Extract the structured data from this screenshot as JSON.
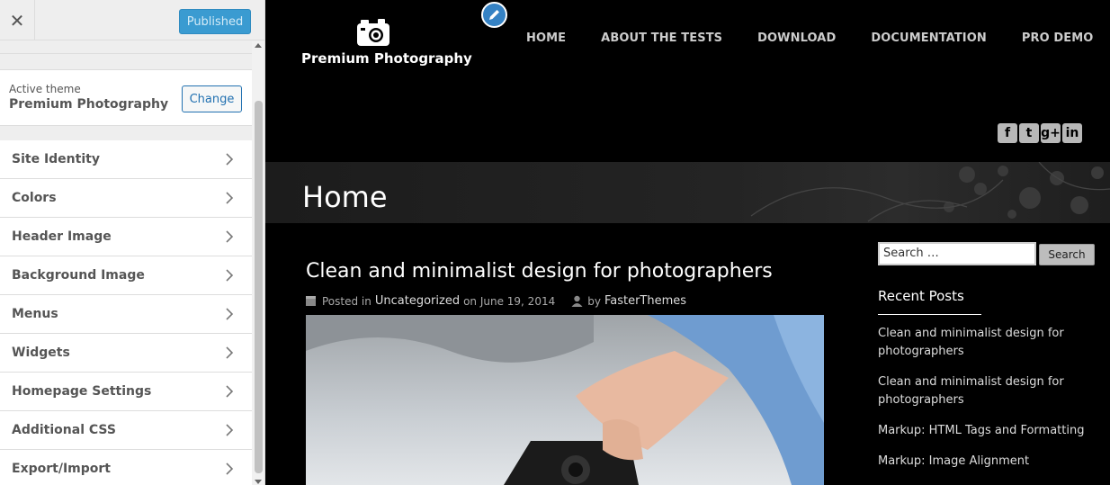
{
  "sidebar": {
    "close_label": "✕",
    "publish_label": "Published",
    "active_theme_label": "Active theme",
    "active_theme_name": "Premium Photography",
    "change_label": "Change",
    "panels": [
      {
        "label": "Site Identity"
      },
      {
        "label": "Colors"
      },
      {
        "label": "Header Image"
      },
      {
        "label": "Background Image"
      },
      {
        "label": "Menus"
      },
      {
        "label": "Widgets"
      },
      {
        "label": "Homepage Settings"
      },
      {
        "label": "Additional CSS"
      },
      {
        "label": "Export/Import"
      }
    ]
  },
  "site": {
    "title": "Premium Photography",
    "nav": [
      "HOME",
      "ABOUT THE TESTS",
      "DOWNLOAD",
      "DOCUMENTATION",
      "PRO DEMO"
    ],
    "social_icons": [
      "facebook-icon",
      "twitter-icon",
      "google-plus-icon",
      "linkedin-icon"
    ],
    "social_glyphs": [
      "f",
      "t",
      "g+",
      "in"
    ],
    "page_heading": "Home"
  },
  "post": {
    "title": "Clean and minimalist design for photographers",
    "posted_in_prefix": "Posted in",
    "category": "Uncategorized",
    "date_text": "on June 19, 2014",
    "by_prefix": "by",
    "author": "FasterThemes"
  },
  "widgets": {
    "search_placeholder": "Search …",
    "search_button": "Search",
    "recent_heading": "Recent Posts",
    "recent_posts": [
      "Clean and minimalist design for photographers",
      "Clean and minimalist design for photographers",
      "Markup: HTML Tags and Formatting",
      "Markup: Image Alignment"
    ]
  },
  "colors": {
    "publish_button": "#3a9bd1",
    "edit_shortcut": "#3582c4",
    "preview_background": "#000000"
  }
}
